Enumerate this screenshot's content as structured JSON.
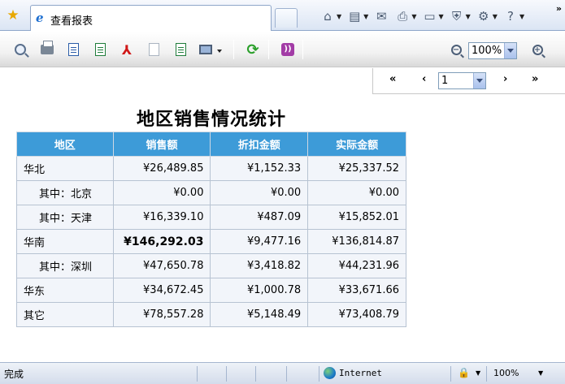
{
  "browser": {
    "tab_title": "查看报表",
    "status_text": "完成",
    "zone_label": "Internet",
    "zoom_label": "100%",
    "overflow_label": "»"
  },
  "toolbar": {
    "zoom_value": "100%"
  },
  "pager": {
    "first": "«",
    "prev": "‹",
    "next": "›",
    "last": "»",
    "page_value": "1"
  },
  "report": {
    "title": "地区销售情况统计",
    "headers": [
      "地区",
      "销售额",
      "折扣金额",
      "实际金额"
    ],
    "rows": [
      {
        "region": "华北",
        "sales": "¥26,489.85",
        "discount": "¥1,152.33",
        "actual": "¥25,337.52"
      },
      {
        "region": "其中：北京",
        "sales": "¥0.00",
        "discount": "¥0.00",
        "actual": "¥0.00"
      },
      {
        "region": "其中：天津",
        "sales": "¥16,339.10",
        "discount": "¥487.09",
        "actual": "¥15,852.01"
      },
      {
        "region": "华南",
        "sales": "¥146,292.03",
        "discount": "¥9,477.16",
        "actual": "¥136,814.87"
      },
      {
        "region": "其中：深圳",
        "sales": "¥47,650.78",
        "discount": "¥3,418.82",
        "actual": "¥44,231.96"
      },
      {
        "region": "华东",
        "sales": "¥34,672.45",
        "discount": "¥1,000.78",
        "actual": "¥33,671.66"
      },
      {
        "region": "其它",
        "sales": "¥78,557.28",
        "discount": "¥5,148.49",
        "actual": "¥73,408.79"
      }
    ]
  }
}
